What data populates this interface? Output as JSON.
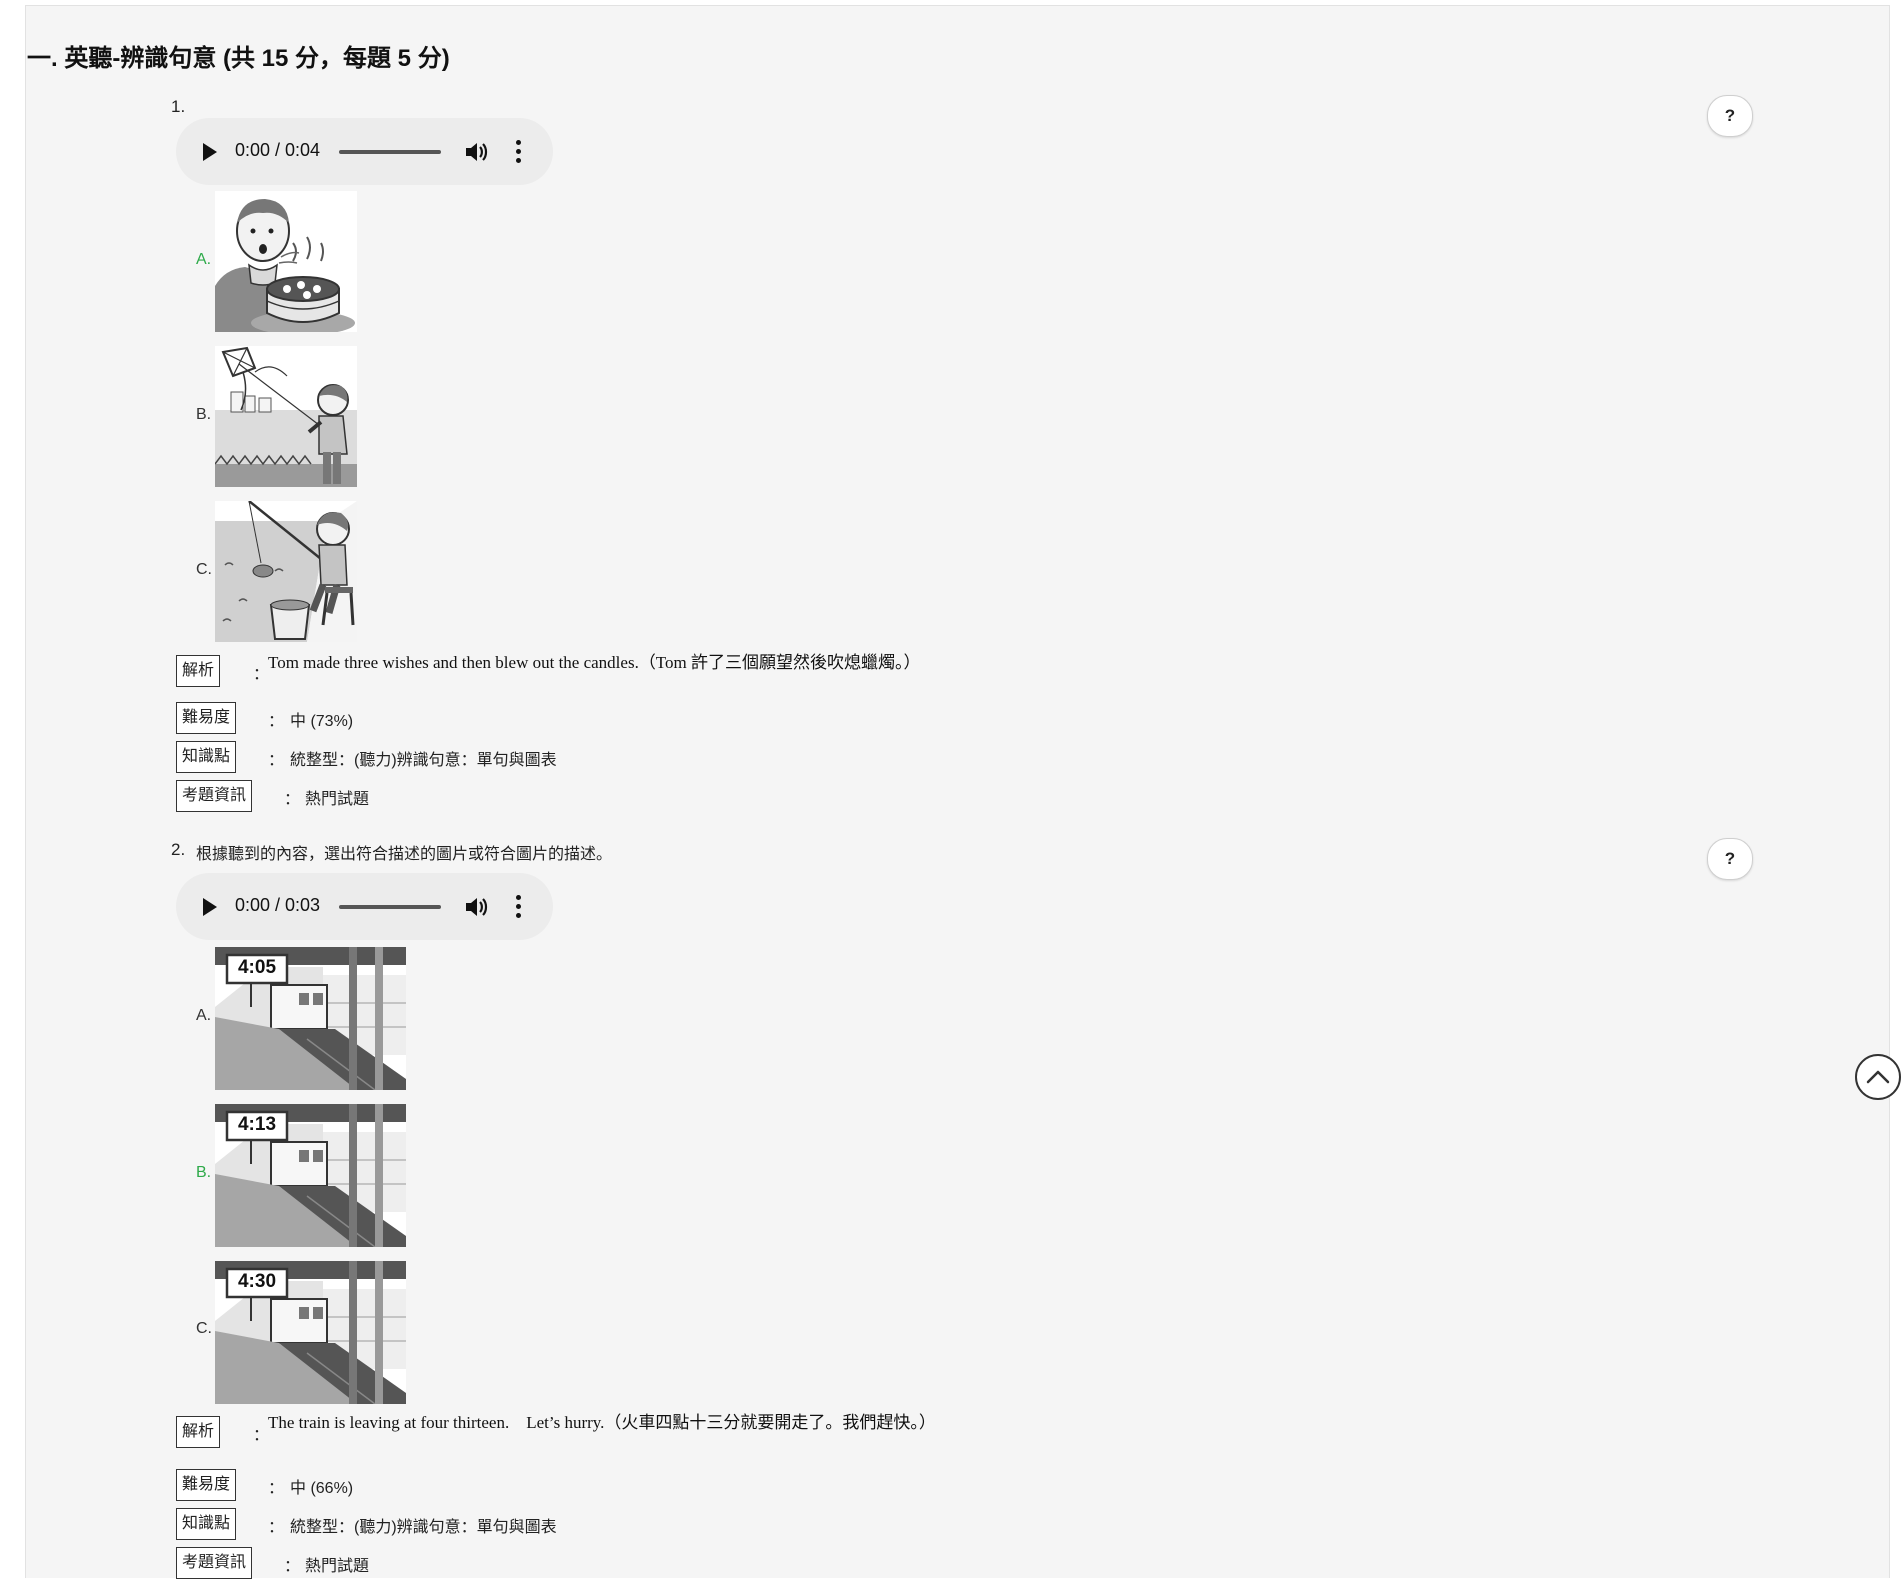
{
  "section": {
    "title": "一. 英聽-辨識句意 (共 15 分，每題 5 分)"
  },
  "labels": {
    "explain_tag": "解析",
    "difficulty_tag": "難易度",
    "knowledge_tag": "知識點",
    "exam_info_tag": "考題資訊",
    "colon": "：",
    "help_button": "?"
  },
  "questions": [
    {
      "number": "1.",
      "prompt": "",
      "audio": {
        "time": "0:00 / 0:04"
      },
      "options": [
        {
          "label": "A.",
          "correct": true,
          "image": "boy-blowing-birthday-cake-candles"
        },
        {
          "label": "B.",
          "correct": false,
          "image": "boy-flying-kite-by-river"
        },
        {
          "label": "C.",
          "correct": false,
          "image": "boy-fishing-by-river"
        }
      ],
      "explanation": "Tom made three wishes and then blew out the candles.（Tom 許了三個願望然後吹熄蠟燭。）",
      "difficulty": "中 (73%)",
      "knowledge": "統整型：(聽力)辨識句意：單句與圖表",
      "exam_info": "熱門試題"
    },
    {
      "number": "2.",
      "prompt": "根據聽到的內容，選出符合描述的圖片或符合圖片的描述。",
      "audio": {
        "time": "0:00 / 0:03"
      },
      "options": [
        {
          "label": "A.",
          "correct": false,
          "image": "train-station-clock",
          "clock": "4:05"
        },
        {
          "label": "B.",
          "correct": true,
          "image": "train-station-clock",
          "clock": "4:13"
        },
        {
          "label": "C.",
          "correct": false,
          "image": "train-station-clock",
          "clock": "4:30"
        }
      ],
      "explanation": "The train is leaving at four thirteen.　Let’s hurry.（火車四點十三分就要開走了。我們趕快。）",
      "difficulty": "中 (66%)",
      "knowledge": "統整型：(聽力)辨識句意：單句與圖表",
      "exam_info": "熱門試題"
    }
  ]
}
